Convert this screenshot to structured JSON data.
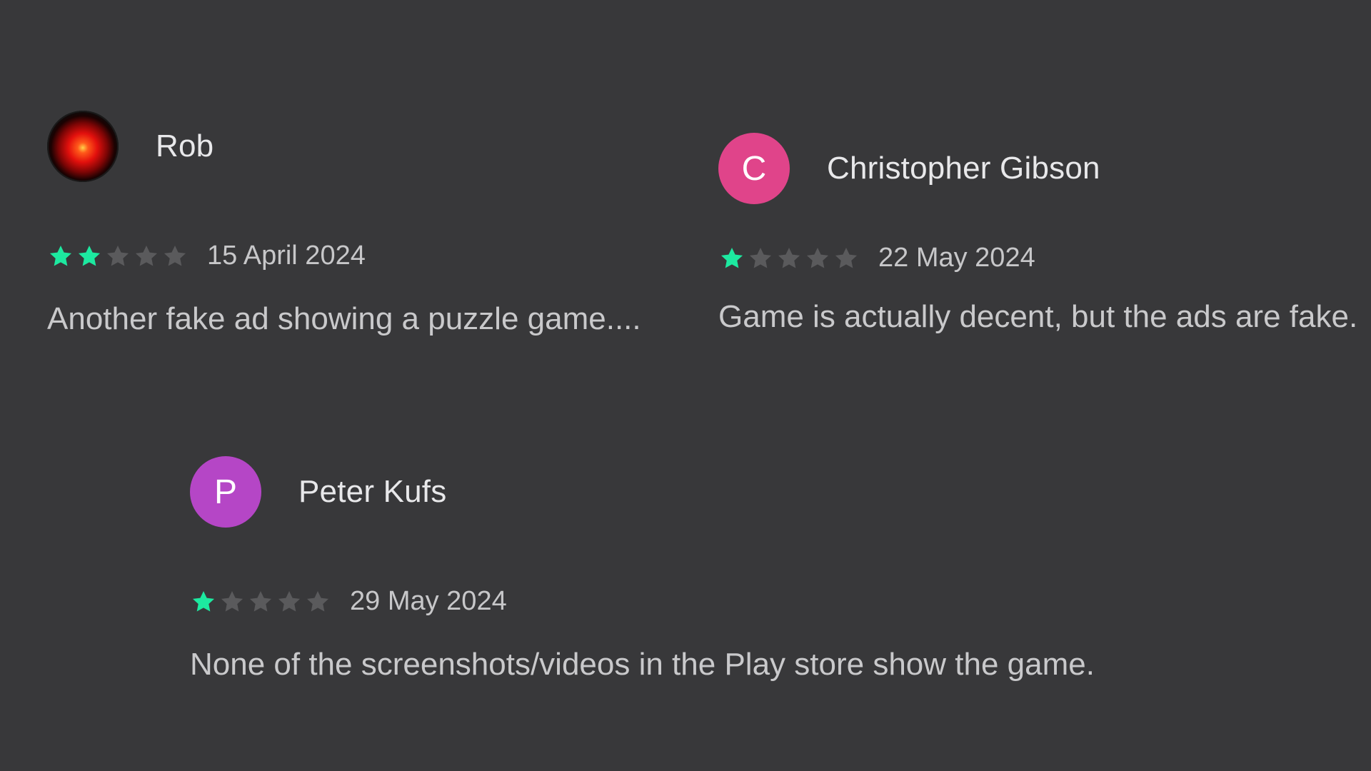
{
  "colors": {
    "background": "#38383a",
    "star_filled": "#1de9a0",
    "star_empty": "#5a5a5c",
    "avatar_c": "#e0448a",
    "avatar_p": "#b546c6"
  },
  "reviews": [
    {
      "author": "Rob",
      "avatar": "hal-9000-eye-icon",
      "rating": 2,
      "max_rating": 5,
      "date": "15 April 2024",
      "text": "Another fake ad showing a puzzle game...."
    },
    {
      "author": "Christopher Gibson",
      "avatar_letter": "C",
      "rating": 1,
      "max_rating": 5,
      "date": "22 May 2024",
      "text": "Game is actually decent, but the ads are fake."
    },
    {
      "author": "Peter Kufs",
      "avatar_letter": "P",
      "rating": 1,
      "max_rating": 5,
      "date": "29 May 2024",
      "text": "None of the screenshots/videos in the Play store show the game."
    }
  ]
}
